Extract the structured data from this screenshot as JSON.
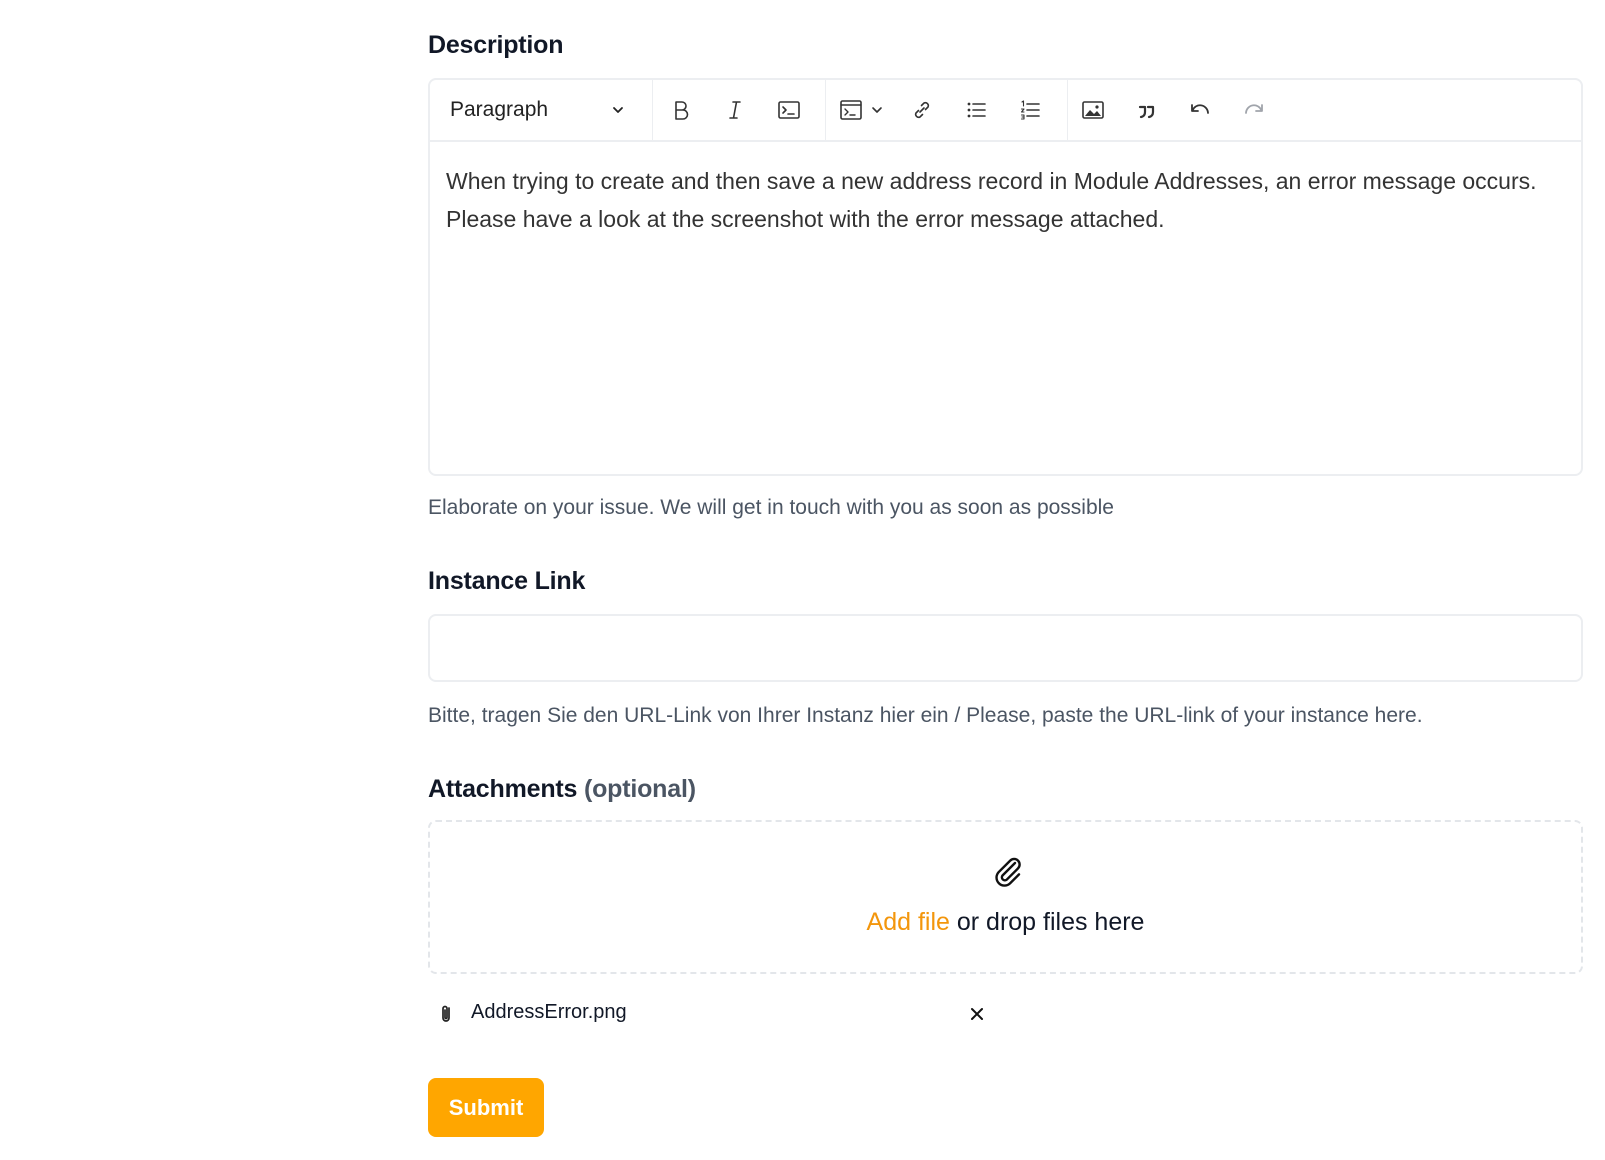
{
  "description": {
    "label": "Description",
    "toolbar": {
      "paragraph_select": "Paragraph",
      "icons": [
        "bold-icon",
        "italic-icon",
        "code-icon",
        "code-block-icon",
        "chevron-down-icon",
        "link-icon",
        "bulleted-list-icon",
        "numbered-list-icon",
        "image-icon",
        "quote-icon",
        "undo-icon",
        "redo-icon"
      ]
    },
    "content": "When trying to create and then save a new address record in Module Addresses, an error message occurs. Please have a look at the screenshot with the error message attached.",
    "help": "Elaborate on your issue. We will get in touch with you as soon as possible"
  },
  "instance_link": {
    "label": "Instance Link",
    "value": "",
    "help": "Bitte, tragen Sie den URL-Link von Ihrer Instanz hier ein / Please, paste the URL-link of your instance here."
  },
  "attachments": {
    "label": "Attachments",
    "optional": "(optional)",
    "dropzone": {
      "icon": "paperclip-icon",
      "add_file": "Add file",
      "drop_text": " or drop files here"
    },
    "files": [
      {
        "name": "AddressError.png",
        "icon": "paperclip-icon",
        "remove_icon": "close-icon"
      }
    ]
  },
  "submit": {
    "label": "Submit"
  },
  "colors": {
    "accent": "#ffa600",
    "link": "#f3960c",
    "border": "#eceef1",
    "help_text": "#4b5563"
  }
}
